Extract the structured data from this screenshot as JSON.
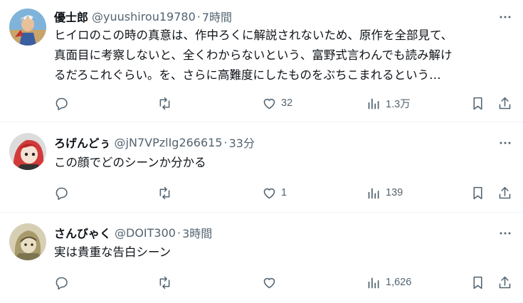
{
  "tweets": [
    {
      "name": "優士郎",
      "handle": "@yuushirou19780",
      "separator": "·",
      "time": "7時間",
      "text": "ヒイロのこの時の真意は、作中ろくに解説されないため、原作を全部見て、\n真面目に考察しないと、全くわからないという、富野式言わんでも読み解け\nるだろこれぐらい。を、さらに高難度にしたものをぶちこまれるという…",
      "likes": "32",
      "views": "1.3万",
      "avatar_icon": "anime-character-avatar"
    },
    {
      "name": "ろげんどぅ",
      "handle": "@jN7VPzlIg266615",
      "separator": "·",
      "time": "33分",
      "text": "この顔でどのシーンか分かる",
      "likes": "1",
      "views": "139",
      "avatar_icon": "red-hair-character-avatar"
    },
    {
      "name": "さんびゃく",
      "handle": "@DOIT300",
      "separator": "·",
      "time": "3時間",
      "text": "実は貴重な告白シーン",
      "likes": "",
      "views": "1,626",
      "avatar_icon": "sketch-character-avatar"
    }
  ],
  "colors": {
    "text": "#0f1419",
    "muted": "#536471",
    "divider": "#eff3f4"
  },
  "icons": [
    "reply-icon",
    "retweet-icon",
    "like-icon",
    "views-icon",
    "bookmark-icon",
    "share-icon",
    "more-icon"
  ]
}
